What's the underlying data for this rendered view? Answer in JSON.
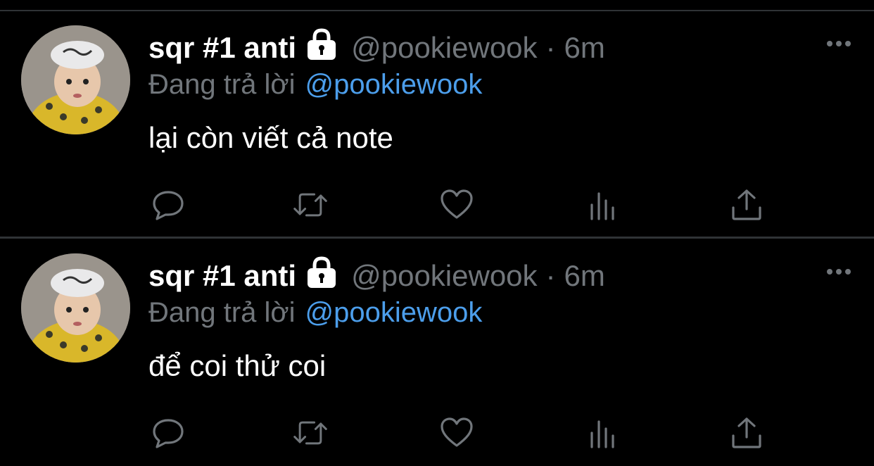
{
  "colors": {
    "background": "#000000",
    "divider": "#2f3336",
    "muted_text": "#71767b",
    "link": "#4c9eeb",
    "primary_text": "#ffffff"
  },
  "tweets": [
    {
      "display_name": "sqr #1 anti",
      "protected_icon": "lock-icon",
      "handle": "@pookiewook",
      "separator": "·",
      "time": "6m",
      "reply_prefix": "Đang trả lời",
      "reply_to": "@pookiewook",
      "text": "lại còn viết cả note",
      "actions": [
        "reply-icon",
        "retweet-icon",
        "like-icon",
        "views-icon",
        "share-icon"
      ]
    },
    {
      "display_name": "sqr #1 anti",
      "protected_icon": "lock-icon",
      "handle": "@pookiewook",
      "separator": "·",
      "time": "6m",
      "reply_prefix": "Đang trả lời",
      "reply_to": "@pookiewook",
      "text": "để coi thử coi",
      "actions": [
        "reply-icon",
        "retweet-icon",
        "like-icon",
        "views-icon",
        "share-icon"
      ]
    }
  ]
}
